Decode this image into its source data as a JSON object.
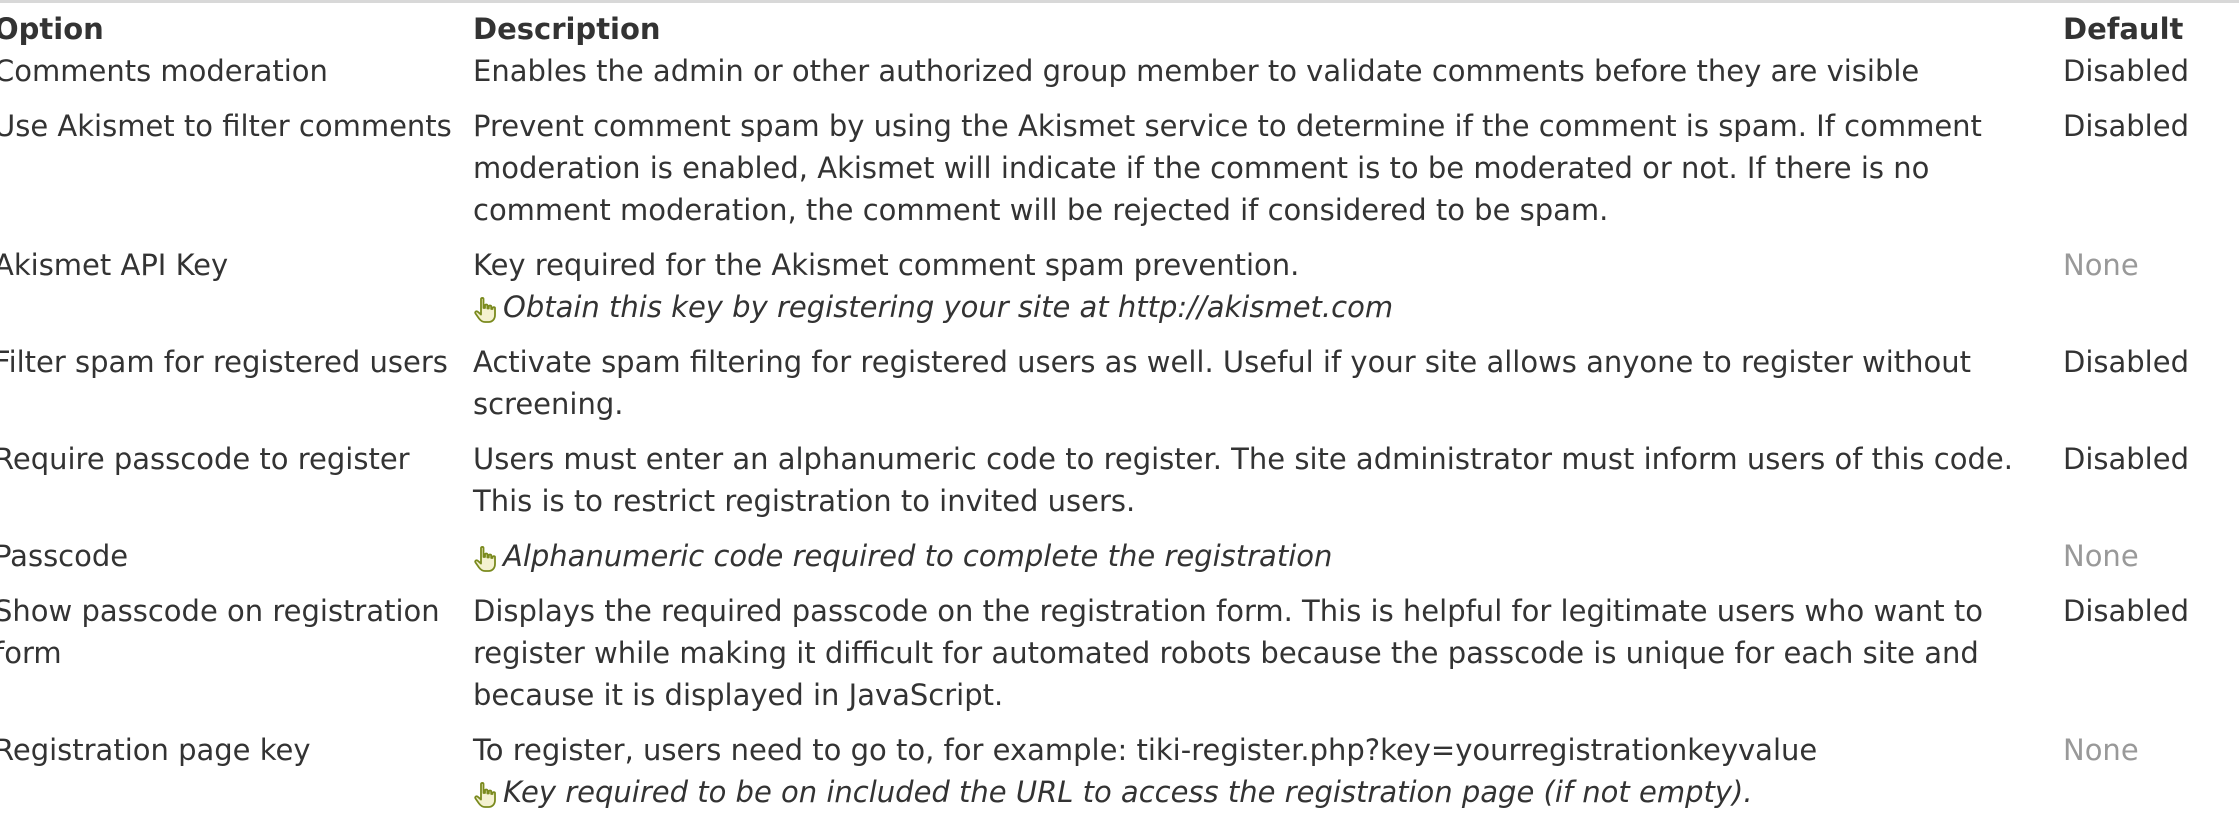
{
  "table": {
    "headers": {
      "option": "Option",
      "description": "Description",
      "default": "Default"
    },
    "rows": [
      {
        "option": "Comments moderation",
        "description": "Enables the admin or other authorized group member to validate comments before they are visible",
        "hint": "",
        "default": "Disabled"
      },
      {
        "option": "Use Akismet to filter comments",
        "description": "Prevent comment spam by using the Akismet service to determine if the comment is spam. If comment moderation is enabled, Akismet will indicate if the comment is to be moderated or not. If there is no comment moderation, the comment will be rejected if considered to be spam.",
        "hint": "",
        "default": "Disabled"
      },
      {
        "option": "Akismet API Key",
        "description": "Key required for the Akismet comment spam prevention.",
        "hint": "Obtain this key by registering your site at http://akismet.com",
        "default": "None"
      },
      {
        "option": "Filter spam for registered users",
        "description": "Activate spam filtering for registered users as well. Useful if your site allows anyone to register without screening.",
        "hint": "",
        "default": "Disabled"
      },
      {
        "option": "Require passcode to register",
        "description": "Users must enter an alphanumeric code to register. The site administrator must inform users of this code. This is to restrict registration to invited users.",
        "hint": "",
        "default": "Disabled"
      },
      {
        "option": "Passcode",
        "description": "",
        "hint": "Alphanumeric code required to complete the registration",
        "default": "None"
      },
      {
        "option": "Show passcode on registration form",
        "description": "Displays the required passcode on the registration form. This is helpful for legitimate users who want to register while making it difficult for automated robots because the passcode is unique for each site and because it is displayed in JavaScript.",
        "hint": "",
        "default": "Disabled"
      },
      {
        "option": "Registration page key",
        "description": "To register, users need to go to, for example: tiki-register.php?key=yourregistrationkeyvalue",
        "hint": "Key required to be on included the URL to access the registration page (if not empty).",
        "default": "None"
      }
    ]
  },
  "icons": {
    "hint": "pointing-hand-icon"
  },
  "colors": {
    "text": "#333333",
    "muted": "#999999",
    "icon": "#7a8a1e"
  }
}
